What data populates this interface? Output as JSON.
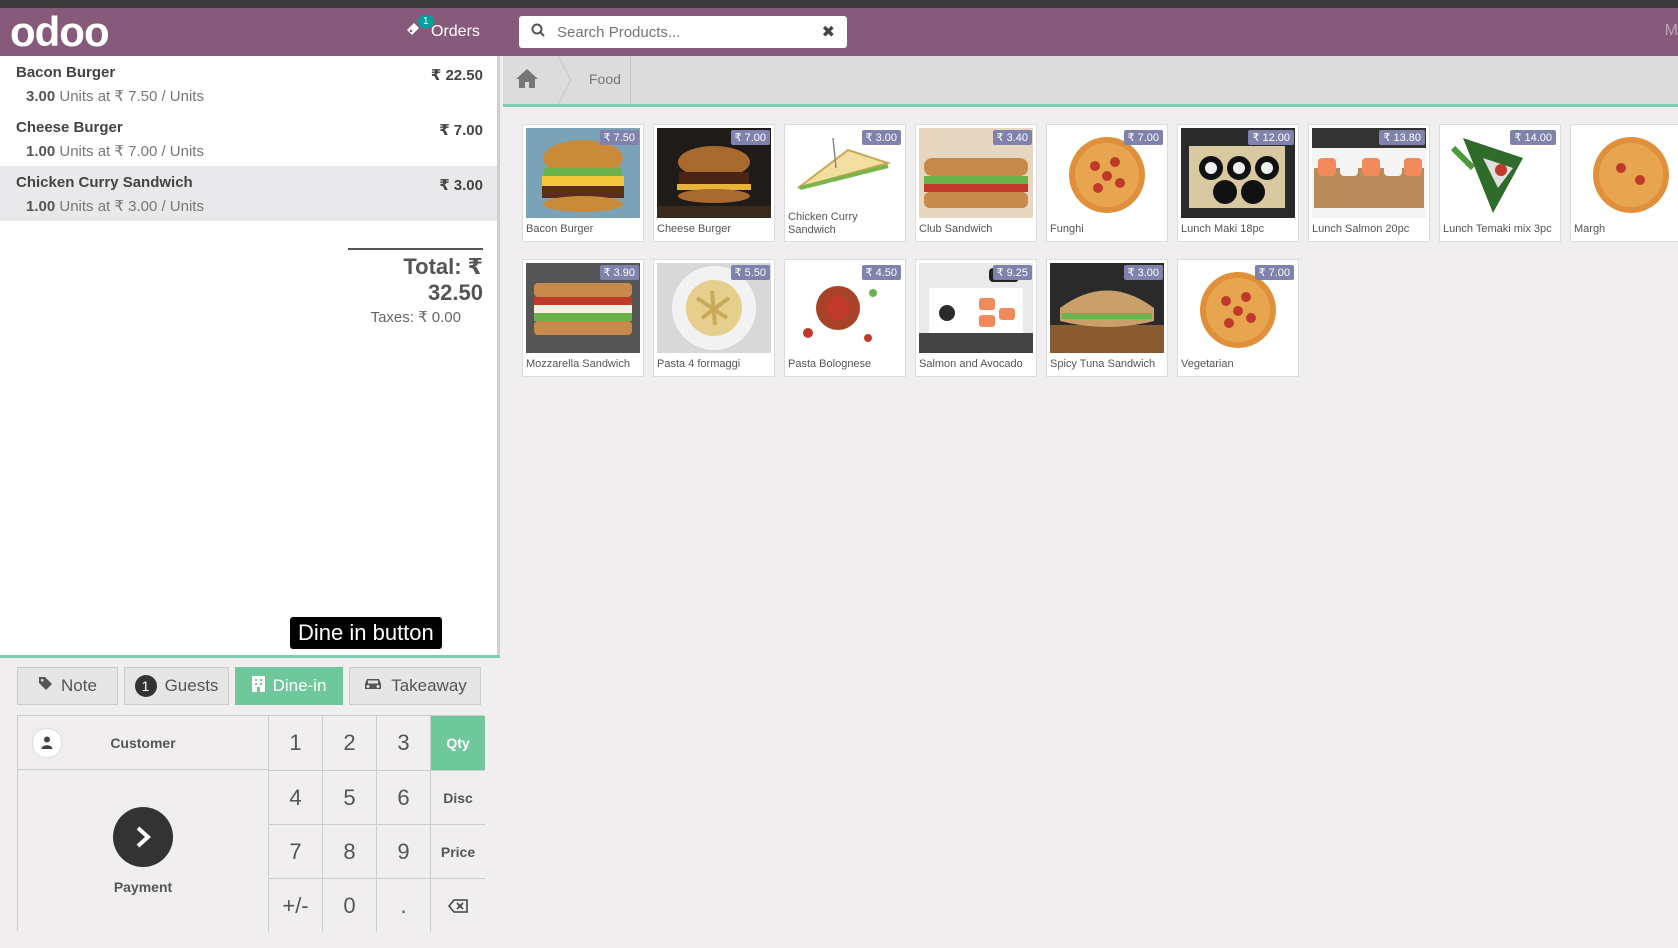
{
  "header": {
    "logo": "odoo",
    "orders_label": "Orders",
    "orders_count": "1",
    "search_placeholder": "Search Products...",
    "right_text": "M"
  },
  "order": {
    "lines": [
      {
        "name": "Bacon Burger",
        "price": "₹ 22.50",
        "qty": "3.00",
        "detail": "Units at ₹ 7.50 / Units"
      },
      {
        "name": "Cheese Burger",
        "price": "₹ 7.00",
        "qty": "1.00",
        "detail": "Units at ₹ 7.00 / Units"
      },
      {
        "name": "Chicken Curry Sandwich",
        "price": "₹ 3.00",
        "qty": "1.00",
        "detail": "Units at ₹ 3.00 / Units"
      }
    ],
    "total": "Total: ₹ 32.50",
    "taxes": "Taxes: ₹ 0.00"
  },
  "tooltip": "Dine in button",
  "controls": {
    "note": "Note",
    "guests_count": "1",
    "guests": "Guests",
    "dine_in": "Dine-in",
    "takeaway": "Takeaway"
  },
  "numpad": {
    "customer": "Customer",
    "payment": "Payment",
    "keys": [
      "1",
      "2",
      "3",
      "4",
      "5",
      "6",
      "7",
      "8",
      "9",
      "+/-",
      "0",
      "."
    ],
    "qty": "Qty",
    "disc": "Disc",
    "price": "Price"
  },
  "breadcrumb": {
    "category": "Food"
  },
  "products": [
    {
      "name": "Bacon Burger",
      "price": "₹ 7.50",
      "img": "burger"
    },
    {
      "name": "Cheese Burger",
      "price": "₹ 7.00",
      "img": "burger-dark"
    },
    {
      "name": "Chicken Curry Sandwich",
      "price": "₹ 3.00",
      "img": "sandwich-tri"
    },
    {
      "name": "Club Sandwich",
      "price": "₹ 3.40",
      "img": "club"
    },
    {
      "name": "Funghi",
      "price": "₹ 7.00",
      "img": "pizza"
    },
    {
      "name": "Lunch Maki 18pc",
      "price": "₹ 12.00",
      "img": "maki"
    },
    {
      "name": "Lunch Salmon 20pc",
      "price": "₹ 13.80",
      "img": "salmon-sushi"
    },
    {
      "name": "Lunch Temaki mix 3pc",
      "price": "₹ 14.00",
      "img": "temaki"
    },
    {
      "name": "Margh",
      "price": "",
      "img": "pizza-cut"
    },
    {
      "name": "Mozzarella Sandwich",
      "price": "₹ 3.90",
      "img": "mozz"
    },
    {
      "name": "Pasta 4 formaggi",
      "price": "₹ 5.50",
      "img": "pasta"
    },
    {
      "name": "Pasta Bolognese",
      "price": "₹ 4.50",
      "img": "bolognese"
    },
    {
      "name": "Salmon and Avocado",
      "price": "₹ 9.25",
      "img": "salmon-avocado"
    },
    {
      "name": "Spicy Tuna Sandwich",
      "price": "₹ 3.00",
      "img": "tuna"
    },
    {
      "name": "Vegetarian",
      "price": "₹ 7.00",
      "img": "pizza"
    }
  ]
}
